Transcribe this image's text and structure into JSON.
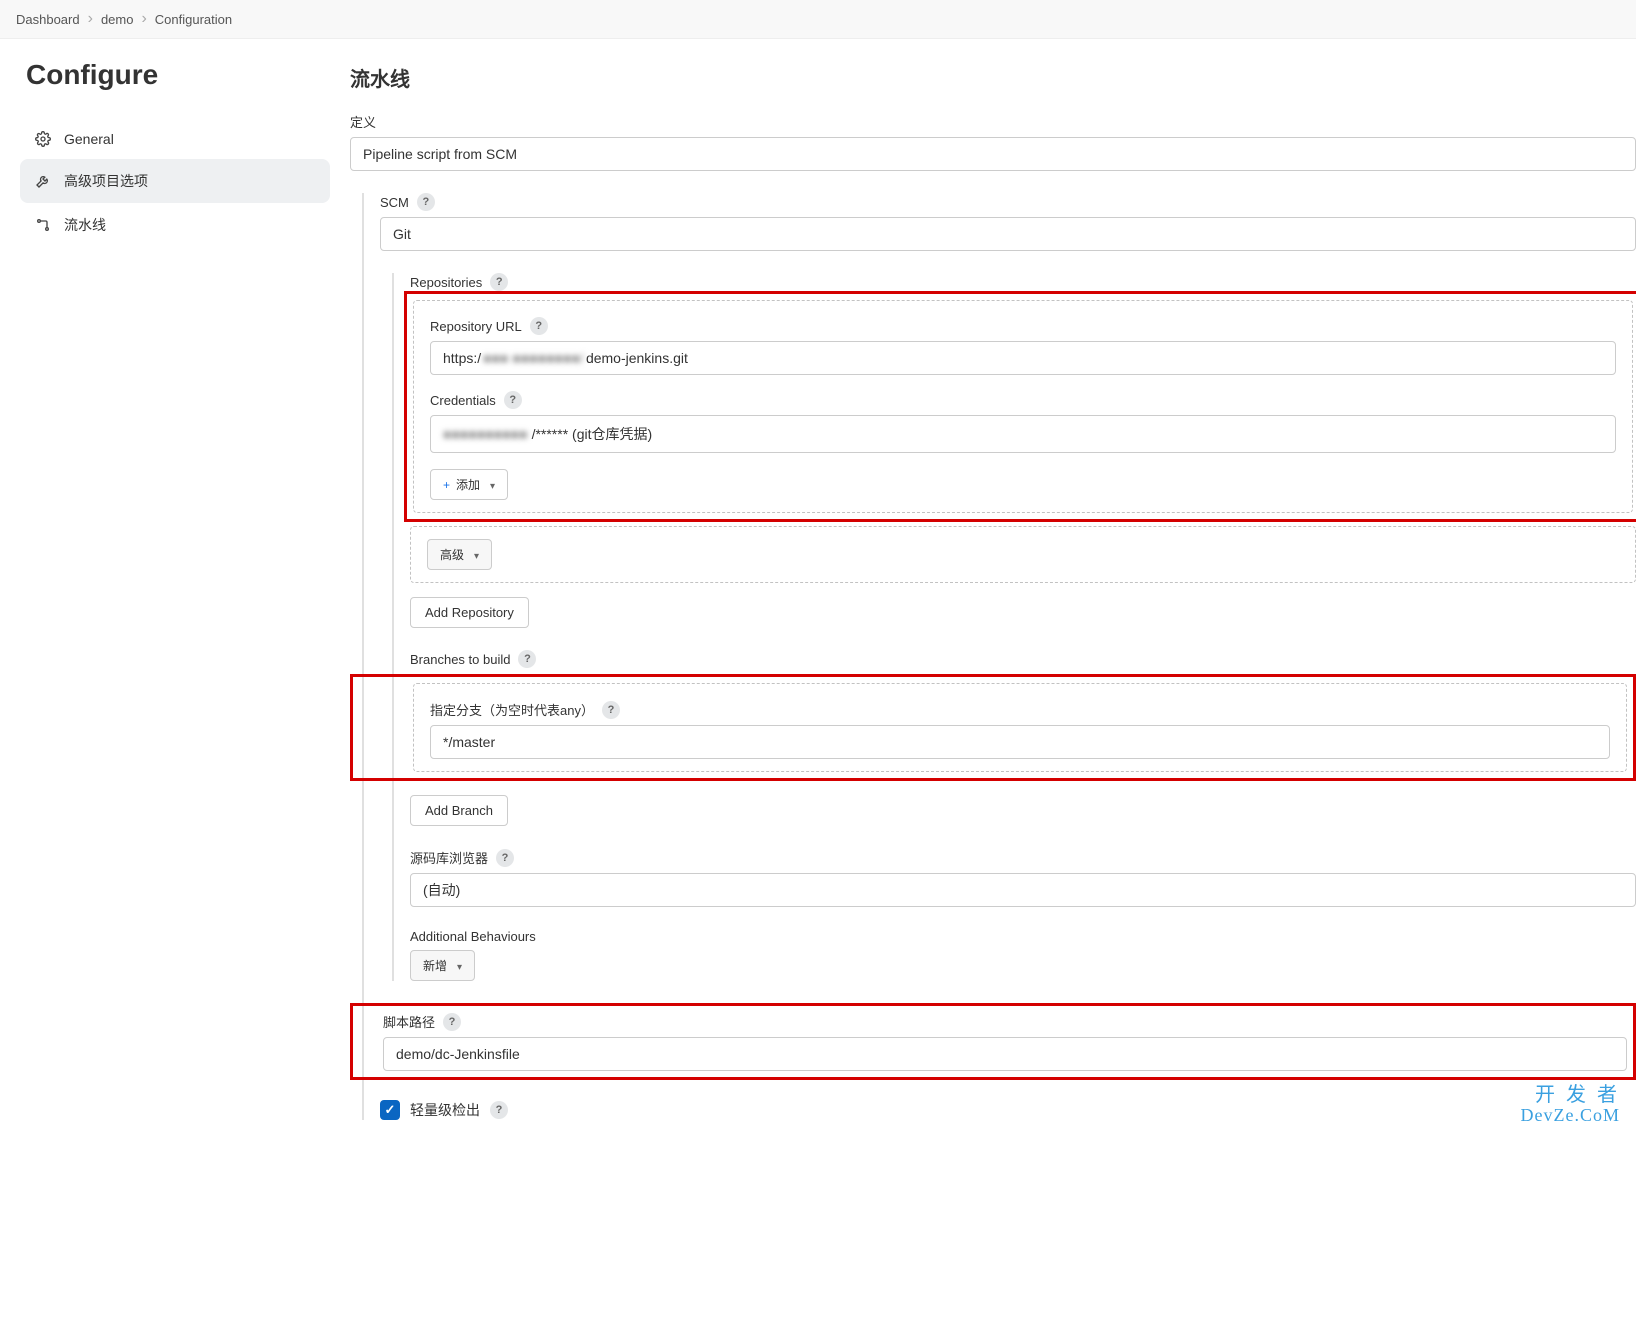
{
  "breadcrumb": {
    "items": [
      "Dashboard",
      "demo",
      "Configuration"
    ]
  },
  "sidebar": {
    "title": "Configure",
    "items": [
      {
        "id": "general",
        "label": "General",
        "icon": "gear"
      },
      {
        "id": "advanced",
        "label": "高级项目选项",
        "icon": "wrench",
        "active": true
      },
      {
        "id": "pipeline",
        "label": "流水线",
        "icon": "pipeline"
      }
    ]
  },
  "main": {
    "section_title": "流水线",
    "definition_label": "定义",
    "definition_value": "Pipeline script from SCM",
    "scm": {
      "label": "SCM",
      "value": "Git",
      "repositories": {
        "label": "Repositories",
        "repo_url_label": "Repository URL",
        "repo_url_prefix": "https:/",
        "repo_url_blur": "■■■ ■■■■■■■■/",
        "repo_url_suffix": "demo-jenkins.git",
        "credentials_label": "Credentials",
        "credentials_blur": "■■■■■■■■■■",
        "credentials_suffix": "/****** (git仓库凭据)",
        "add_button": "添加",
        "advanced_button": "高级",
        "add_repository_button": "Add Repository"
      },
      "branches": {
        "label": "Branches to build",
        "branch_spec_label": "指定分支（为空时代表any）",
        "branch_spec_value": "*/master",
        "add_branch_button": "Add Branch"
      },
      "repo_browser": {
        "label": "源码库浏览器",
        "value": "(自动)"
      },
      "additional": {
        "label": "Additional Behaviours",
        "add_button": "新增"
      }
    },
    "script_path": {
      "label": "脚本路径",
      "value": "demo/dc-Jenkinsfile"
    },
    "lightweight": {
      "label": "轻量级检出",
      "checked": true
    }
  },
  "watermark": {
    "line1": "开 发 者",
    "line2": "DevZe.CoM"
  }
}
